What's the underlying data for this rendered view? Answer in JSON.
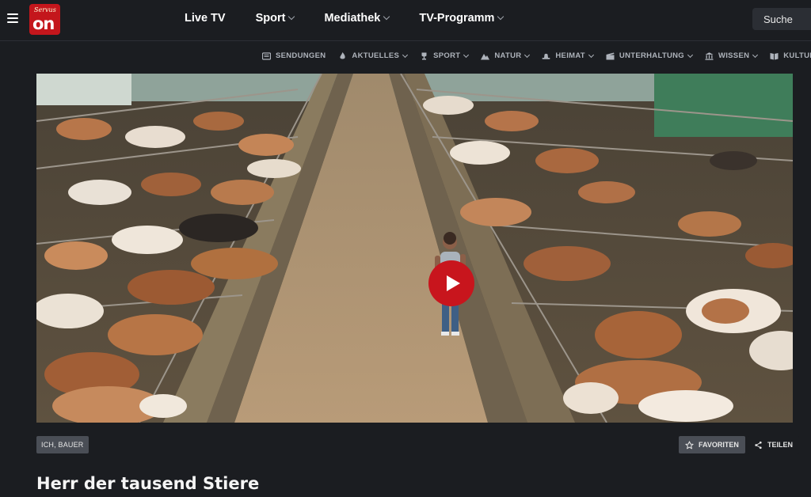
{
  "header": {
    "logo_script": "Servus",
    "logo_text": "on",
    "nav": [
      "Live TV",
      "Sport",
      "Mediathek",
      "TV-Programm"
    ],
    "search_label": "Suche"
  },
  "subnav": [
    "SENDUNGEN",
    "AKTUELLES",
    "SPORT",
    "NATUR",
    "HEIMAT",
    "UNTERHALTUNG",
    "WISSEN",
    "KULTUR"
  ],
  "video": {
    "tag": "ICH, BAUER",
    "favorite_label": "FAVORITEN",
    "share_label": "TEILEN",
    "title": "Herr der tausend Stiere"
  },
  "icons": {
    "menu": "hamburger-icon",
    "play": "play-icon",
    "favorite": "star-icon",
    "share": "share-icon"
  },
  "colors": {
    "brand_red": "#c4161c",
    "background": "#1b1d21",
    "chip": "#4a4e56"
  }
}
